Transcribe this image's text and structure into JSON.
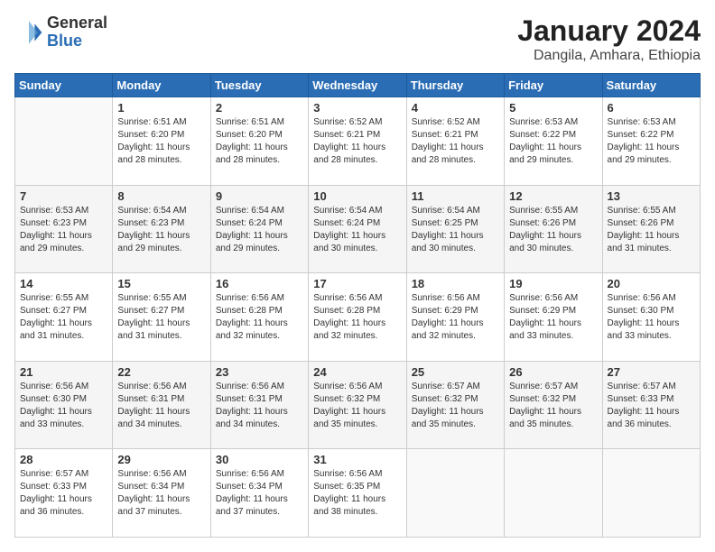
{
  "header": {
    "logo": {
      "general": "General",
      "blue": "Blue"
    },
    "title": "January 2024",
    "subtitle": "Dangila, Amhara, Ethiopia"
  },
  "days_of_week": [
    "Sunday",
    "Monday",
    "Tuesday",
    "Wednesday",
    "Thursday",
    "Friday",
    "Saturday"
  ],
  "weeks": [
    [
      {
        "day": "",
        "info": ""
      },
      {
        "day": "1",
        "info": "Sunrise: 6:51 AM\nSunset: 6:20 PM\nDaylight: 11 hours\nand 28 minutes."
      },
      {
        "day": "2",
        "info": "Sunrise: 6:51 AM\nSunset: 6:20 PM\nDaylight: 11 hours\nand 28 minutes."
      },
      {
        "day": "3",
        "info": "Sunrise: 6:52 AM\nSunset: 6:21 PM\nDaylight: 11 hours\nand 28 minutes."
      },
      {
        "day": "4",
        "info": "Sunrise: 6:52 AM\nSunset: 6:21 PM\nDaylight: 11 hours\nand 28 minutes."
      },
      {
        "day": "5",
        "info": "Sunrise: 6:53 AM\nSunset: 6:22 PM\nDaylight: 11 hours\nand 29 minutes."
      },
      {
        "day": "6",
        "info": "Sunrise: 6:53 AM\nSunset: 6:22 PM\nDaylight: 11 hours\nand 29 minutes."
      }
    ],
    [
      {
        "day": "7",
        "info": "Sunrise: 6:53 AM\nSunset: 6:23 PM\nDaylight: 11 hours\nand 29 minutes."
      },
      {
        "day": "8",
        "info": "Sunrise: 6:54 AM\nSunset: 6:23 PM\nDaylight: 11 hours\nand 29 minutes."
      },
      {
        "day": "9",
        "info": "Sunrise: 6:54 AM\nSunset: 6:24 PM\nDaylight: 11 hours\nand 29 minutes."
      },
      {
        "day": "10",
        "info": "Sunrise: 6:54 AM\nSunset: 6:24 PM\nDaylight: 11 hours\nand 30 minutes."
      },
      {
        "day": "11",
        "info": "Sunrise: 6:54 AM\nSunset: 6:25 PM\nDaylight: 11 hours\nand 30 minutes."
      },
      {
        "day": "12",
        "info": "Sunrise: 6:55 AM\nSunset: 6:26 PM\nDaylight: 11 hours\nand 30 minutes."
      },
      {
        "day": "13",
        "info": "Sunrise: 6:55 AM\nSunset: 6:26 PM\nDaylight: 11 hours\nand 31 minutes."
      }
    ],
    [
      {
        "day": "14",
        "info": "Sunrise: 6:55 AM\nSunset: 6:27 PM\nDaylight: 11 hours\nand 31 minutes."
      },
      {
        "day": "15",
        "info": "Sunrise: 6:55 AM\nSunset: 6:27 PM\nDaylight: 11 hours\nand 31 minutes."
      },
      {
        "day": "16",
        "info": "Sunrise: 6:56 AM\nSunset: 6:28 PM\nDaylight: 11 hours\nand 32 minutes."
      },
      {
        "day": "17",
        "info": "Sunrise: 6:56 AM\nSunset: 6:28 PM\nDaylight: 11 hours\nand 32 minutes."
      },
      {
        "day": "18",
        "info": "Sunrise: 6:56 AM\nSunset: 6:29 PM\nDaylight: 11 hours\nand 32 minutes."
      },
      {
        "day": "19",
        "info": "Sunrise: 6:56 AM\nSunset: 6:29 PM\nDaylight: 11 hours\nand 33 minutes."
      },
      {
        "day": "20",
        "info": "Sunrise: 6:56 AM\nSunset: 6:30 PM\nDaylight: 11 hours\nand 33 minutes."
      }
    ],
    [
      {
        "day": "21",
        "info": "Sunrise: 6:56 AM\nSunset: 6:30 PM\nDaylight: 11 hours\nand 33 minutes."
      },
      {
        "day": "22",
        "info": "Sunrise: 6:56 AM\nSunset: 6:31 PM\nDaylight: 11 hours\nand 34 minutes."
      },
      {
        "day": "23",
        "info": "Sunrise: 6:56 AM\nSunset: 6:31 PM\nDaylight: 11 hours\nand 34 minutes."
      },
      {
        "day": "24",
        "info": "Sunrise: 6:56 AM\nSunset: 6:32 PM\nDaylight: 11 hours\nand 35 minutes."
      },
      {
        "day": "25",
        "info": "Sunrise: 6:57 AM\nSunset: 6:32 PM\nDaylight: 11 hours\nand 35 minutes."
      },
      {
        "day": "26",
        "info": "Sunrise: 6:57 AM\nSunset: 6:32 PM\nDaylight: 11 hours\nand 35 minutes."
      },
      {
        "day": "27",
        "info": "Sunrise: 6:57 AM\nSunset: 6:33 PM\nDaylight: 11 hours\nand 36 minutes."
      }
    ],
    [
      {
        "day": "28",
        "info": "Sunrise: 6:57 AM\nSunset: 6:33 PM\nDaylight: 11 hours\nand 36 minutes."
      },
      {
        "day": "29",
        "info": "Sunrise: 6:56 AM\nSunset: 6:34 PM\nDaylight: 11 hours\nand 37 minutes."
      },
      {
        "day": "30",
        "info": "Sunrise: 6:56 AM\nSunset: 6:34 PM\nDaylight: 11 hours\nand 37 minutes."
      },
      {
        "day": "31",
        "info": "Sunrise: 6:56 AM\nSunset: 6:35 PM\nDaylight: 11 hours\nand 38 minutes."
      },
      {
        "day": "",
        "info": ""
      },
      {
        "day": "",
        "info": ""
      },
      {
        "day": "",
        "info": ""
      }
    ]
  ]
}
